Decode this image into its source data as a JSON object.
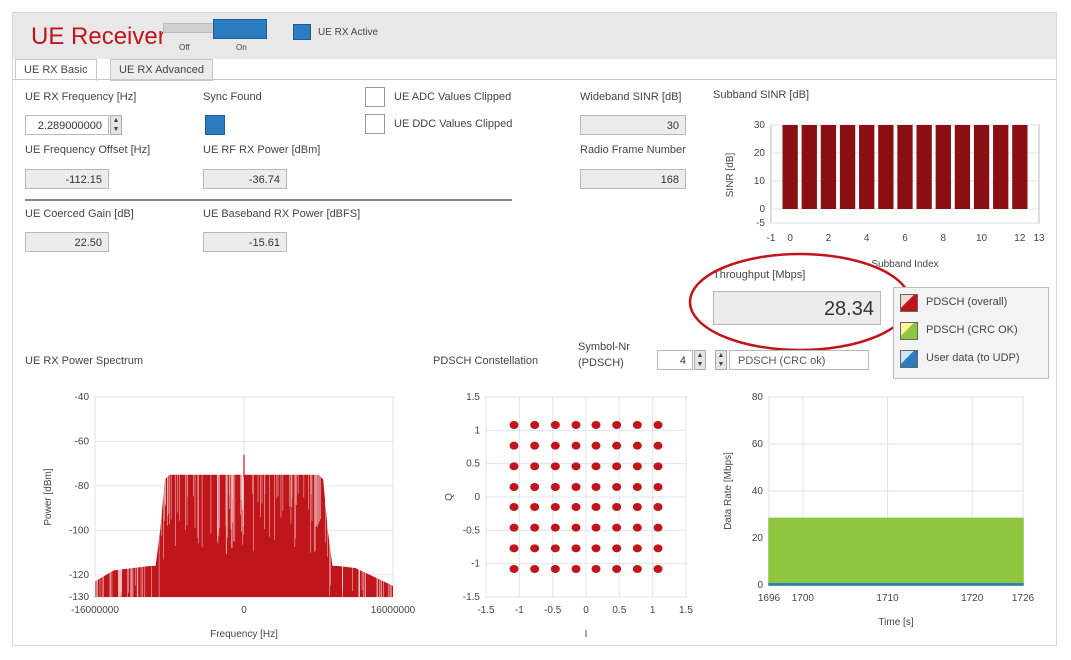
{
  "header": {
    "title": "UE Receiver",
    "toggle_off": "Off",
    "toggle_on": "On",
    "active_label": "UE RX Active"
  },
  "tabs": [
    {
      "label": "UE RX Basic"
    },
    {
      "label": "UE RX Advanced"
    }
  ],
  "fields": {
    "rx_freq_label": "UE RX Frequency [Hz]",
    "rx_freq_value": "2.289000000",
    "sync_label": "Sync Found",
    "adc_clipped_label": "UE ADC Values Clipped",
    "ddc_clipped_label": "UE DDC Values Clipped",
    "wideband_sinr_label": "Wideband SINR [dB]",
    "wideband_sinr_value": "30",
    "freq_offset_label": "UE Frequency Offset [Hz]",
    "freq_offset_value": "-112.15",
    "rf_power_label": "UE RF RX Power [dBm]",
    "rf_power_value": "-36.74",
    "radio_frame_label": "Radio Frame Number",
    "radio_frame_value": "168",
    "coerced_gain_label": "UE Coerced Gain [dB]",
    "coerced_gain_value": "22.50",
    "bb_power_label": "UE Baseband RX Power [dBFS]",
    "bb_power_value": "-15.61"
  },
  "throughput": {
    "label": "Throughput [Mbps]",
    "value": "28.34",
    "legend": [
      {
        "label": "PDSCH (overall)",
        "color": "#c0151a"
      },
      {
        "label": "PDSCH (CRC OK)",
        "color": "#8ec63f"
      },
      {
        "label": "User data (to UDP)",
        "color": "#2c7dc0"
      }
    ]
  },
  "constellation_controls": {
    "title": "PDSCH Constellation",
    "symbol_label_1": "Symbol-Nr",
    "symbol_label_2": "(PDSCH)",
    "symbol_value": "4",
    "select_value": "PDSCH (CRC ok)"
  },
  "chart_data": [
    {
      "id": "subband_sinr",
      "type": "bar",
      "title": "Subband SINR [dB]",
      "xlabel": "Subband Index",
      "ylabel": "SINR [dB]",
      "x": [
        0,
        1,
        2,
        3,
        4,
        5,
        6,
        7,
        8,
        9,
        10,
        11,
        12
      ],
      "values": [
        30,
        30,
        30,
        30,
        30,
        30,
        30,
        30,
        30,
        30,
        30,
        30,
        30
      ],
      "xlim": [
        -1,
        13
      ],
      "ylim": [
        -5,
        30
      ],
      "xticks": [
        "-1",
        "0",
        "2",
        "4",
        "6",
        "8",
        "10",
        "12",
        "13"
      ],
      "yticks": [
        "-5",
        "0",
        "10",
        "20",
        "30"
      ],
      "color": "#8b0e12"
    },
    {
      "id": "power_spectrum",
      "type": "area",
      "title": "UE RX Power Spectrum",
      "xlabel": "Frequency [Hz]",
      "ylabel": "Power [dBm]",
      "xlim": [
        -16000000,
        16000000
      ],
      "ylim": [
        -130,
        -40
      ],
      "xticks": [
        "-16000000",
        "0",
        "16000000"
      ],
      "yticks": [
        "-40",
        "-60",
        "-80",
        "-100",
        "-120",
        "-130"
      ],
      "profile": {
        "x": [
          -16000000,
          -14000000,
          -12000000,
          -10000000,
          -9500000,
          -9000000,
          -8500000,
          -8000000,
          8000000,
          8500000,
          9000000,
          9500000,
          10000000,
          12000000,
          14000000,
          16000000
        ],
        "y": [
          -123,
          -118,
          -117,
          -116,
          -116,
          -100,
          -77,
          -75,
          -75,
          -77,
          -100,
          -116,
          -116,
          -117,
          -121,
          -125
        ]
      },
      "color": "#c0151a"
    },
    {
      "id": "constellation",
      "type": "scatter",
      "xlabel": "I",
      "ylabel": "Q",
      "xlim": [
        -1.5,
        1.5
      ],
      "ylim": [
        -1.5,
        1.5
      ],
      "xticks": [
        "-1.5",
        "-1",
        "-0.5",
        "0",
        "0.5",
        "1",
        "1.5"
      ],
      "yticks": [
        "1.5",
        "1",
        "0.5",
        "0",
        "-0.5",
        "-1",
        "-1.5"
      ],
      "levels": [
        -1.08,
        -0.77,
        -0.46,
        -0.15,
        0.15,
        0.46,
        0.77,
        1.08
      ],
      "color": "#c0151a"
    },
    {
      "id": "data_rate",
      "type": "area",
      "xlabel": "Time [s]",
      "ylabel": "Data Rate [Mbps]",
      "xlim": [
        1696,
        1726
      ],
      "ylim": [
        0,
        80
      ],
      "xticks": [
        "1696",
        "1700",
        "1710",
        "1720",
        "1726"
      ],
      "yticks": [
        "80",
        "60",
        "40",
        "20",
        "0"
      ],
      "series": [
        {
          "name": "PDSCH (CRC OK)",
          "x": [
            1696,
            1726
          ],
          "values": [
            28.34,
            28.34
          ],
          "color": "#8ec63f"
        },
        {
          "name": "User data (to UDP)",
          "x": [
            1696,
            1726
          ],
          "values": [
            0.5,
            0.5
          ],
          "color": "#2c7dc0"
        }
      ]
    }
  ]
}
